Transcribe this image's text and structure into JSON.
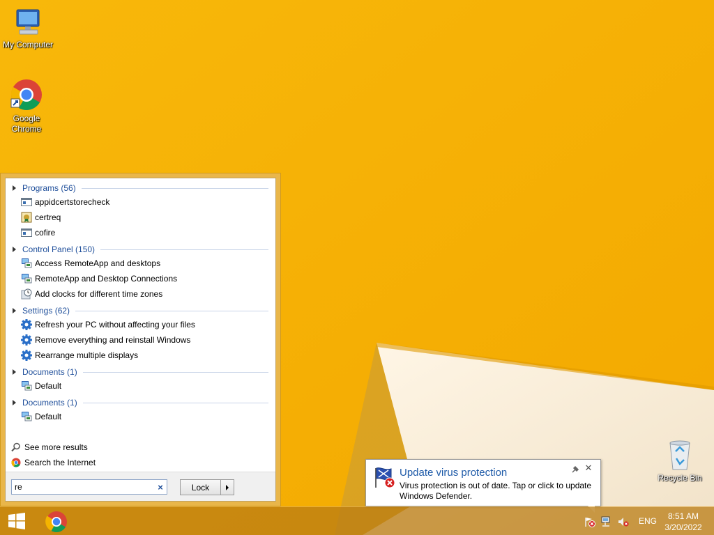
{
  "desktop": {
    "icons": [
      {
        "label": "My Computer"
      },
      {
        "label": "Google Chrome"
      },
      {
        "label": "Recycle Bin"
      }
    ]
  },
  "start_menu": {
    "groups": [
      {
        "header": "Programs (56)",
        "items": [
          "appidcertstorecheck",
          "certreq",
          "cofire"
        ]
      },
      {
        "header": "Control Panel (150)",
        "items": [
          "Access RemoteApp and desktops",
          "RemoteApp and Desktop Connections",
          "Add clocks for different time zones"
        ]
      },
      {
        "header": "Settings (62)",
        "items": [
          "Refresh your PC without affecting your files",
          "Remove everything and reinstall Windows",
          "Rearrange multiple displays"
        ]
      },
      {
        "header": "Documents (1)",
        "items": [
          "Default"
        ]
      },
      {
        "header": "Documents (1)",
        "items": [
          "Default"
        ]
      }
    ],
    "see_more": "See more results",
    "search_internet": "Search the Internet",
    "search_value": "re",
    "clear_symbol": "×",
    "lock_label": "Lock"
  },
  "notification": {
    "title": "Update virus protection",
    "message": "Virus protection is out of date. Tap or click to update Windows Defender.",
    "close_symbol": "✕"
  },
  "taskbar": {
    "language": "ENG",
    "time": "8:51 AM",
    "date": "3/20/2022"
  },
  "colors": {
    "accent_link": "#1e4e9a",
    "wallpaper": "#f6b400",
    "notification_title": "#1e5aa8"
  }
}
